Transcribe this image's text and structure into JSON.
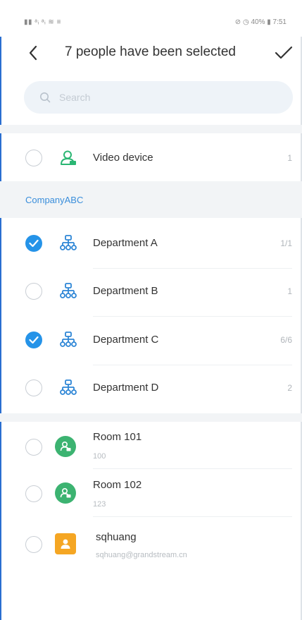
{
  "status_bar": {
    "left_text": "▮▮ ᵃᵢ ᵃᵢ ≋ ≡",
    "right_text": "⊘ ◷ 40% ▮ 7:51"
  },
  "header": {
    "title": "7 people have been selected",
    "back_icon": "chevron-left-icon",
    "confirm_icon": "checkmark-icon"
  },
  "search": {
    "placeholder": "Search"
  },
  "video_device": {
    "label": "Video device",
    "count": "1",
    "checked": false
  },
  "company": {
    "name": "CompanyABC",
    "departments": [
      {
        "label": "Department A",
        "count": "1/1",
        "checked": true
      },
      {
        "label": "Department B",
        "count": "1",
        "checked": false
      },
      {
        "label": "Department C",
        "count": "6/6",
        "checked": true
      },
      {
        "label": "Department D",
        "count": "2",
        "checked": false
      }
    ]
  },
  "contacts": [
    {
      "name": "Room 101",
      "sub": "100",
      "avatar_color": "#3cb371",
      "avatar": "room-icon"
    },
    {
      "name": "Room 102",
      "sub": "123",
      "avatar_color": "#3cb371",
      "avatar": "room-icon"
    },
    {
      "name": "sqhuang",
      "sub": "sqhuang@grandstream.cn",
      "avatar_color": "#f5a623",
      "avatar": "user-icon"
    }
  ],
  "colors": {
    "accent": "#2593e8",
    "section_label": "#3a8edb",
    "room_avatar": "#3cb371",
    "user_avatar": "#f5a623",
    "org_icon": "#2e86d6"
  }
}
